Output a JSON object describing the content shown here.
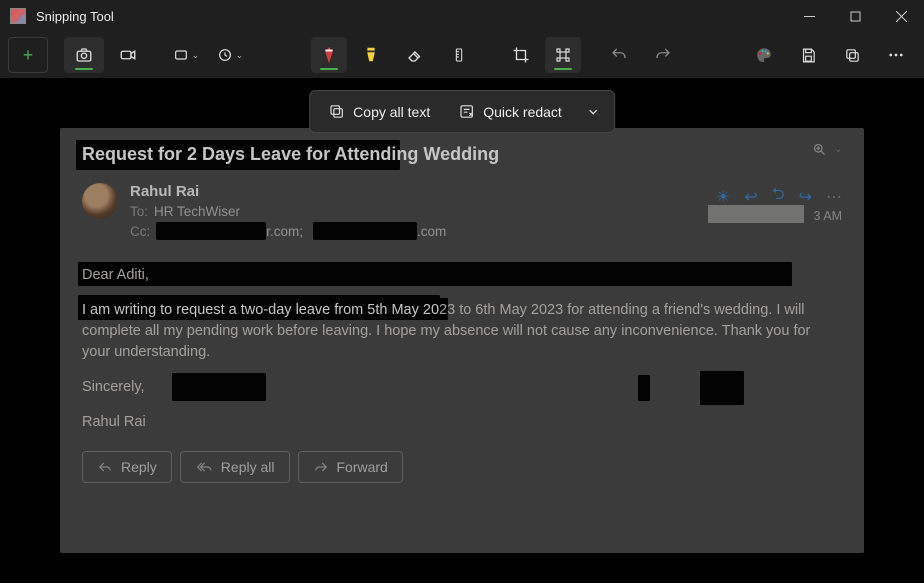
{
  "app": {
    "title": "Snipping Tool"
  },
  "actionbar": {
    "copy_all": "Copy all text",
    "quick_redact": "Quick redact"
  },
  "email": {
    "subject": "Request for 2 Days Leave for Attending Wedding",
    "sender": "Rahul Rai",
    "to_label": "To:",
    "to_value": "HR TechWiser",
    "cc_label": "Cc:",
    "cc_frag1": "r.com;",
    "cc_frag2": ".com",
    "time_suffix": "3 AM",
    "greeting": "Dear Aditi,",
    "body_line1a": "I am writing to request a two-day leave from 5th May 20",
    "body_line1b": "23 to 6th May 2023 for attending a friend's wedding. I will",
    "body_line2": "complete all my pending work before leaving. I hope my absence will not cause any inconvenience. Thank you for your understanding.",
    "signoff": "Sincerely,",
    "signature": "Rahul Rai",
    "reply": "Reply",
    "reply_all": "Reply all",
    "forward": "Forward"
  }
}
